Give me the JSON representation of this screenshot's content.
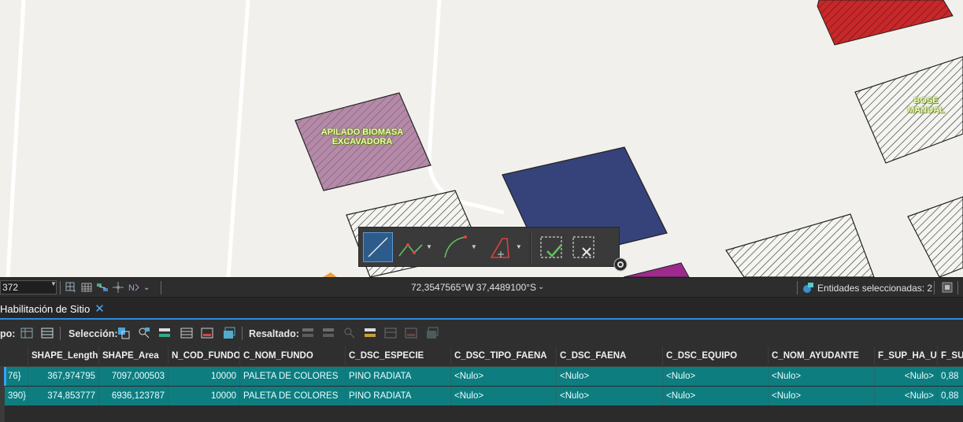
{
  "map": {
    "labels": {
      "biomasa": "APILADO BIOMASA\nEXCAVADORA",
      "right": "BOSE\nMANUAL"
    },
    "colors": {
      "background": "#f1f0ec",
      "pink_polygon": "#b48aa8",
      "blue_polygon": "#36437a",
      "red_polygon": "#c7282a",
      "magenta_polygon": "#9e2a8d"
    }
  },
  "edit_toolbar": {
    "tools": [
      {
        "icon": "line-segment-icon",
        "active": true
      },
      {
        "icon": "polyline-icon"
      },
      {
        "icon": "arc-icon"
      },
      {
        "icon": "polygon-icon"
      },
      {
        "icon": "finish-sketch-icon"
      },
      {
        "icon": "cancel-sketch-icon"
      }
    ]
  },
  "status_bar": {
    "scale": "372",
    "coordinates": "72,3547565°W 37,4489100°S",
    "selected_features": "Entidades seleccionadas: 2"
  },
  "tab": {
    "title": "Habilitación de Sitio",
    "close": "✕"
  },
  "table_toolbar": {
    "view_label": "po:",
    "selection_label": "Selección:",
    "highlight_label": "Resaltado:"
  },
  "table": {
    "columns": [
      "SHAPE_Length",
      "SHAPE_Area",
      "N_COD_FUNDO",
      "C_NOM_FUNDO",
      "C_DSC_ESPECIE",
      "C_DSC_TIPO_FAENA",
      "C_DSC_FAENA",
      "C_DSC_EQUIPO",
      "C_NOM_AYUDANTE",
      "F_SUP_HA_UP",
      "F_SU"
    ],
    "rows": [
      {
        "id": "76}",
        "cells": [
          "367,974795",
          "7097,000503",
          "10000",
          "PALETA DE COLORES",
          "PINO RADIATA",
          "<Nulo>",
          "<Nulo>",
          "<Nulo>",
          "<Nulo>",
          "<Nulo>",
          "0,88"
        ]
      },
      {
        "id": "390}",
        "cells": [
          "374,853777",
          "6936,123787",
          "10000",
          "PALETA DE COLORES",
          "PINO RADIATA",
          "<Nulo>",
          "<Nulo>",
          "<Nulo>",
          "<Nulo>",
          "<Nulo>",
          "0,88"
        ]
      }
    ]
  }
}
